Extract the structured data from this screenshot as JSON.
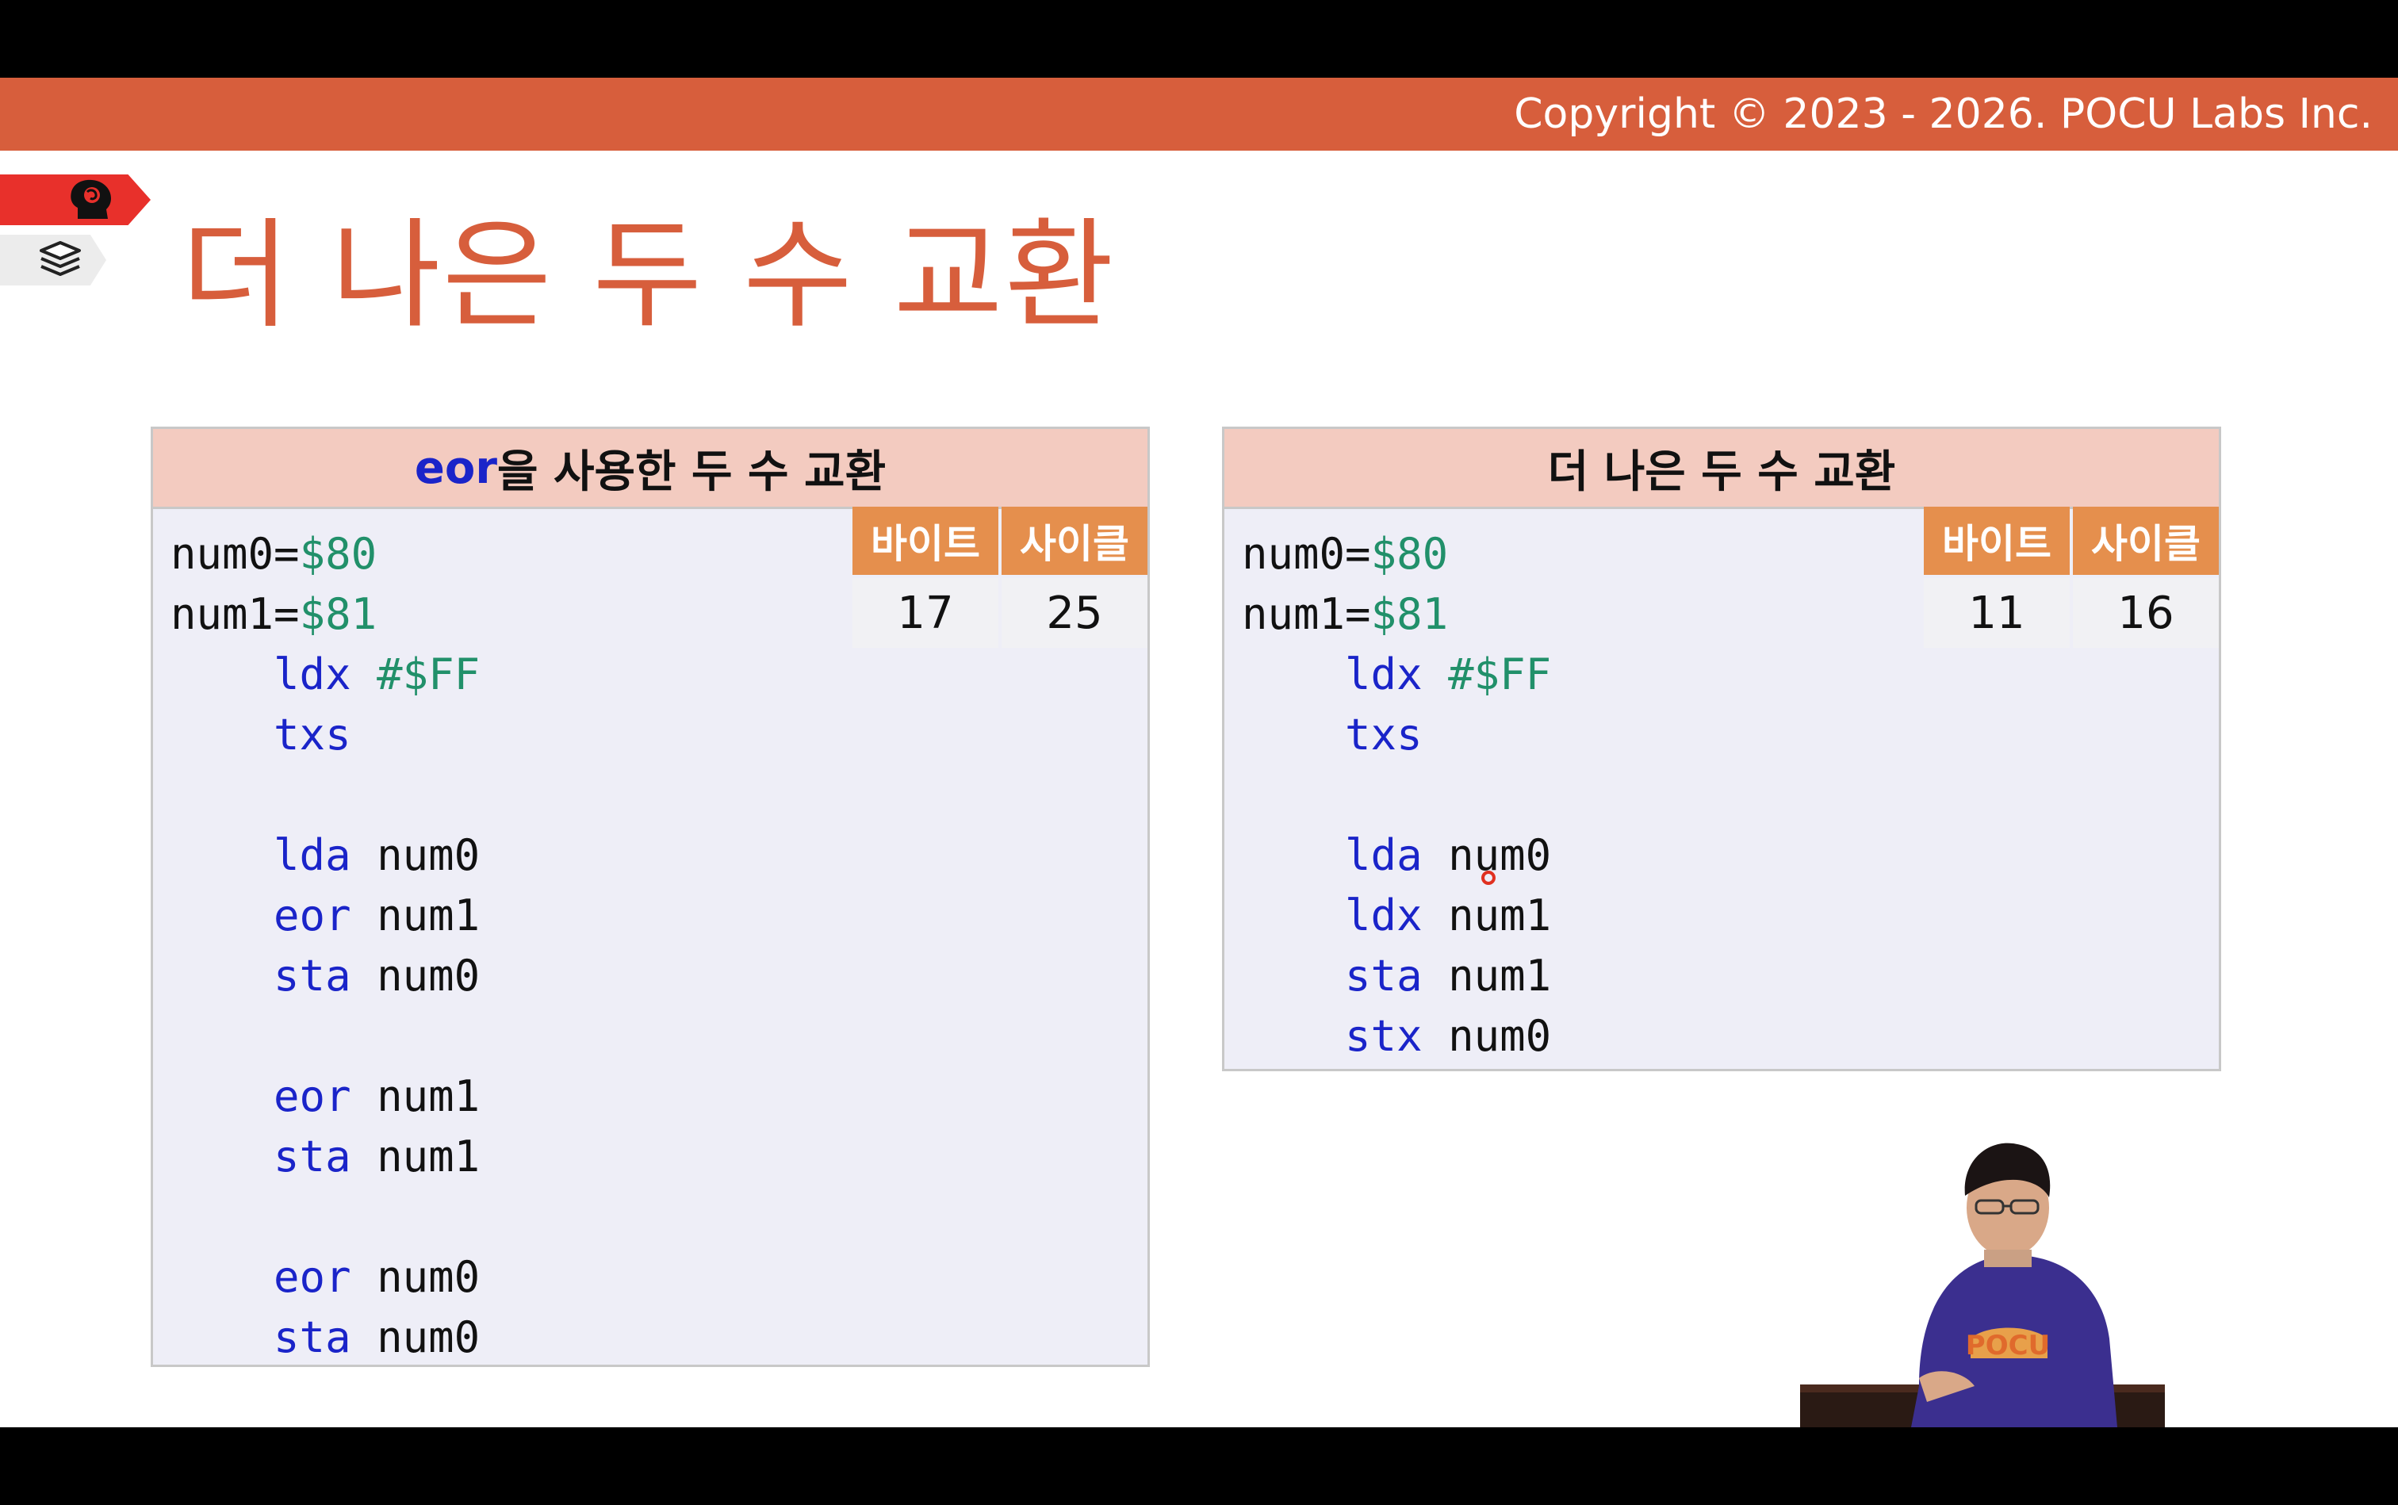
{
  "header": {
    "copyright": "Copyright © 2023 - 2026. POCU Labs Inc."
  },
  "slide": {
    "title": "더 나은 두 수 교환"
  },
  "left_panel": {
    "title_keyword": "eor",
    "title_rest": "을 사용한 두 수 교환",
    "stats": {
      "bytes_label": "바이트",
      "cycles_label": "사이클",
      "bytes": "17",
      "cycles": "25"
    },
    "code": [
      {
        "a": "num0=",
        "b": "$80",
        "t": "label"
      },
      {
        "a": "num1=",
        "b": "$81",
        "t": "label"
      },
      {
        "a": "ldx",
        "b": "#$FF",
        "t": "imm"
      },
      {
        "a": "txs",
        "b": "",
        "t": "op"
      },
      {
        "a": "",
        "b": "",
        "t": "blank"
      },
      {
        "a": "lda",
        "b": "num0",
        "t": "op"
      },
      {
        "a": "eor",
        "b": "num1",
        "t": "op"
      },
      {
        "a": "sta",
        "b": "num0",
        "t": "op"
      },
      {
        "a": "",
        "b": "",
        "t": "blank"
      },
      {
        "a": "eor",
        "b": "num1",
        "t": "op"
      },
      {
        "a": "sta",
        "b": "num1",
        "t": "op"
      },
      {
        "a": "",
        "b": "",
        "t": "blank"
      },
      {
        "a": "eor",
        "b": "num0",
        "t": "op"
      },
      {
        "a": "sta",
        "b": "num0",
        "t": "op"
      }
    ]
  },
  "right_panel": {
    "title": "더 나은 두 수 교환",
    "stats": {
      "bytes_label": "바이트",
      "cycles_label": "사이클",
      "bytes": "11",
      "cycles": "16"
    },
    "code": [
      {
        "a": "num0=",
        "b": "$80",
        "t": "label"
      },
      {
        "a": "num1=",
        "b": "$81",
        "t": "label"
      },
      {
        "a": "ldx",
        "b": "#$FF",
        "t": "imm"
      },
      {
        "a": "txs",
        "b": "",
        "t": "op"
      },
      {
        "a": "",
        "b": "",
        "t": "blank"
      },
      {
        "a": "lda",
        "b": "num0",
        "t": "op"
      },
      {
        "a": "ldx",
        "b": "num1",
        "t": "op"
      },
      {
        "a": "sta",
        "b": "num1",
        "t": "op"
      },
      {
        "a": "stx",
        "b": "num0",
        "t": "op"
      }
    ]
  },
  "presenter": {
    "shirt_text": "POCU"
  },
  "colors": {
    "accent": "#d75e3c",
    "keyword": "#1a24c9",
    "number": "#21906a",
    "panel_header": "#f3cbc0",
    "stats_header": "#e58f4d"
  },
  "icons": [
    "brain-head-icon",
    "stack-layers-icon"
  ]
}
